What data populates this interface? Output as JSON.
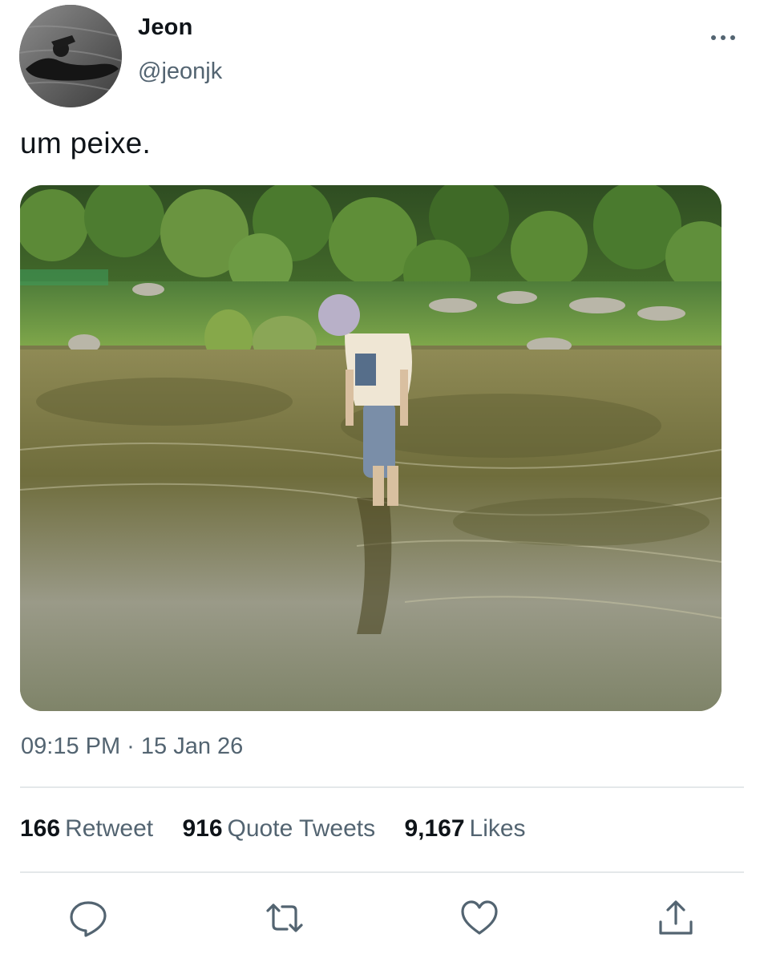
{
  "author": {
    "display_name": "Jeon",
    "handle": "@jeonjk",
    "avatar_icon": "avatar-photo"
  },
  "more_icon": "more-horizontal-icon",
  "tweet": {
    "text": "um peixe.",
    "timestamp": "09:15 PM · 15 Jan 26"
  },
  "stats": {
    "retweets": {
      "count": "166",
      "label": "Retweet"
    },
    "quotes": {
      "count": "916",
      "label": "Quote Tweets"
    },
    "likes": {
      "count": "9,167",
      "label": "Likes"
    }
  },
  "actions": [
    "reply-icon",
    "retweet-icon",
    "like-icon",
    "share-icon"
  ],
  "colors": {
    "text_primary": "#0f1419",
    "text_secondary": "#536471",
    "icon": "#536471",
    "divider": "#e4e8ea"
  }
}
